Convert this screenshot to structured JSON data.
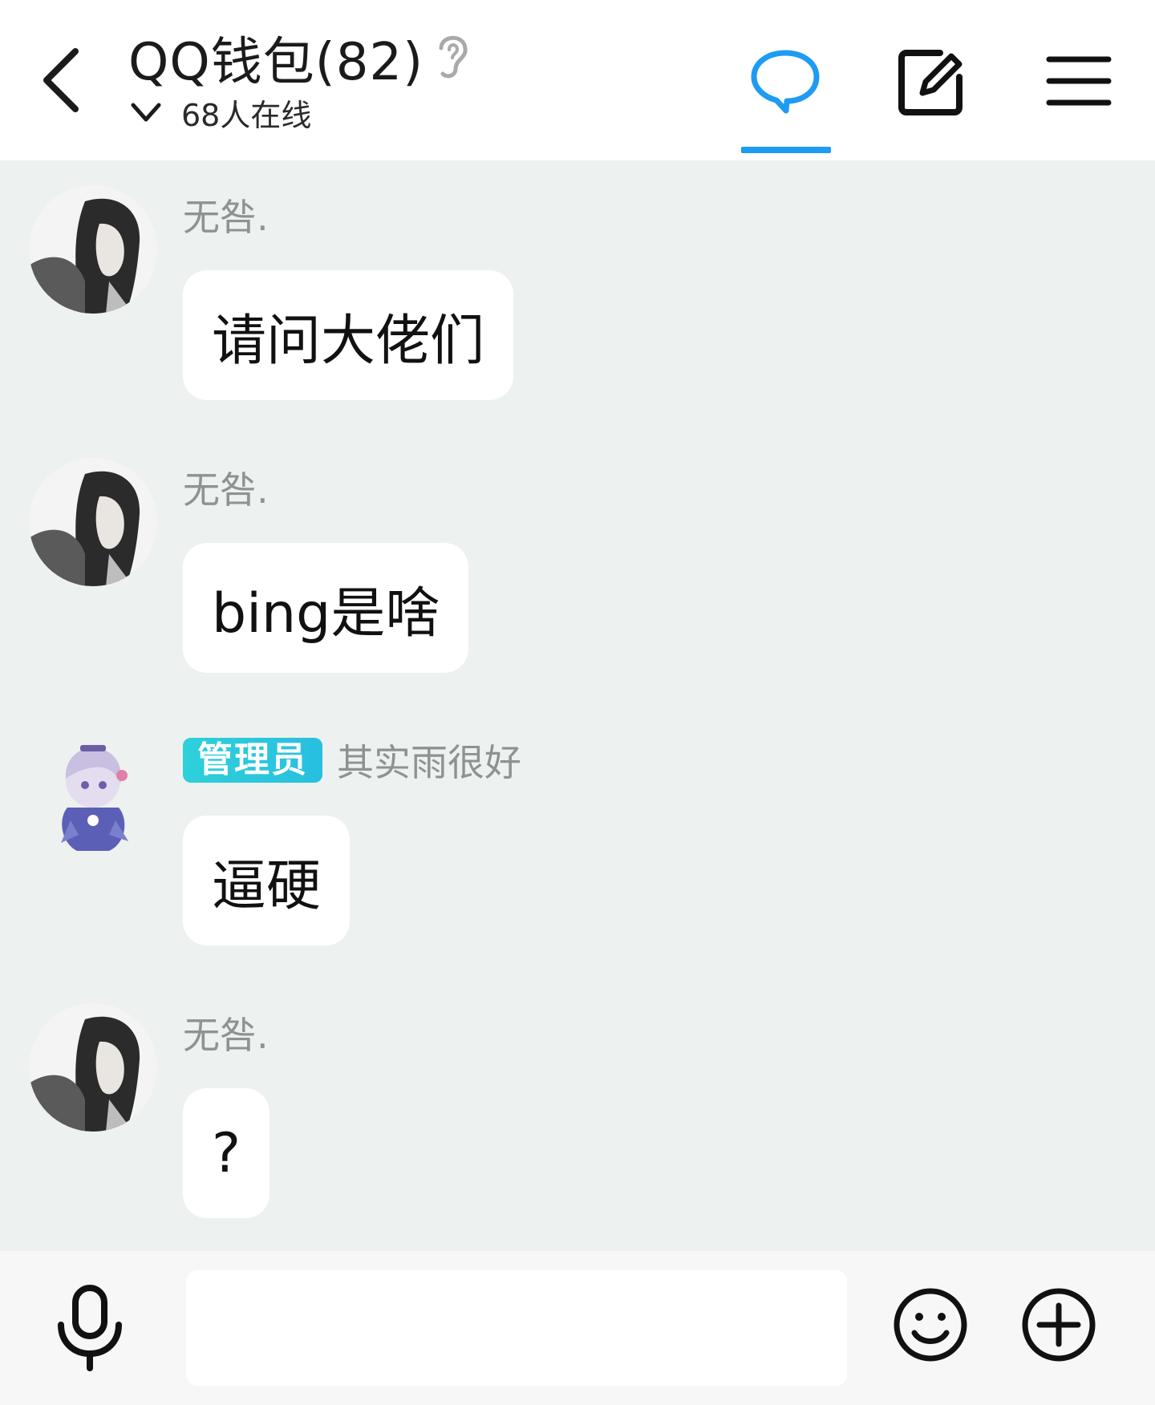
{
  "header": {
    "title": "QQ钱包(82)",
    "online_count": "68人在线",
    "icons": {
      "back": "chevron-left-icon",
      "hearing": "ear-icon",
      "chat_tab": "chat-bubble-icon",
      "edit": "edit-icon",
      "menu": "menu-icon"
    },
    "accent_color": "#1e9bf3"
  },
  "messages": [
    {
      "sender": "无咎.",
      "text": "请问大佬们",
      "avatar": "ink-portrait"
    },
    {
      "sender": "无咎.",
      "text": "bing是啥",
      "avatar": "ink-portrait"
    },
    {
      "badge": "管理员",
      "sender": "其实雨很好",
      "text": "逼硬",
      "avatar": "anime-chibi"
    },
    {
      "sender": "无咎.",
      "text": "?",
      "avatar": "ink-portrait"
    }
  ],
  "input_bar": {
    "placeholder": "",
    "icons": {
      "voice": "microphone-icon",
      "emoji": "smiley-icon",
      "more": "plus-circle-icon"
    }
  },
  "colors": {
    "background": "#edf1ef",
    "bubble": "#ffffff",
    "admin_badge": "#2bc8dd",
    "sender_text": "#8e9292"
  }
}
